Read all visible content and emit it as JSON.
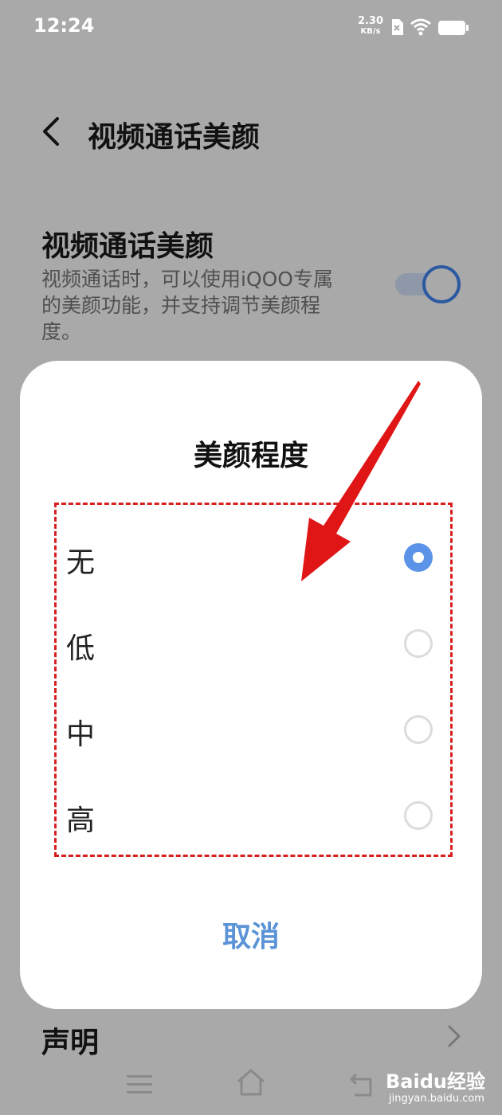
{
  "status_bar": {
    "time": "12:24",
    "net_speed_value": "2.30",
    "net_speed_unit": "KB/s",
    "sim_icon": "sim-blocked-icon",
    "wifi_icon": "wifi-icon",
    "battery_icon": "battery-icon"
  },
  "header": {
    "back_icon": "chevron-left-icon",
    "title": "视频通话美颜"
  },
  "setting": {
    "title": "视频通话美颜",
    "description": "视频通话时，可以使用iQOO专属的美颜功能，并支持调节美颜程度。",
    "toggle_on": true,
    "toggle_color": "#2c5aa0"
  },
  "dialog": {
    "title": "美颜程度",
    "options": [
      {
        "label": "无",
        "selected": true
      },
      {
        "label": "低",
        "selected": false
      },
      {
        "label": "中",
        "selected": false
      },
      {
        "label": "高",
        "selected": false
      }
    ],
    "cancel_label": "取消",
    "accent_color": "#5b93e8",
    "annotation_color": "#d81e1e"
  },
  "statement": {
    "label": "声明",
    "chevron_icon": "chevron-right-icon"
  },
  "nav_bar": {
    "menu_icon": "menu-icon",
    "home_icon": "home-icon",
    "back_icon": "back-arrow-icon"
  },
  "watermark": {
    "main": "Baidu经验",
    "sub": "jingyan.baidu.com"
  }
}
